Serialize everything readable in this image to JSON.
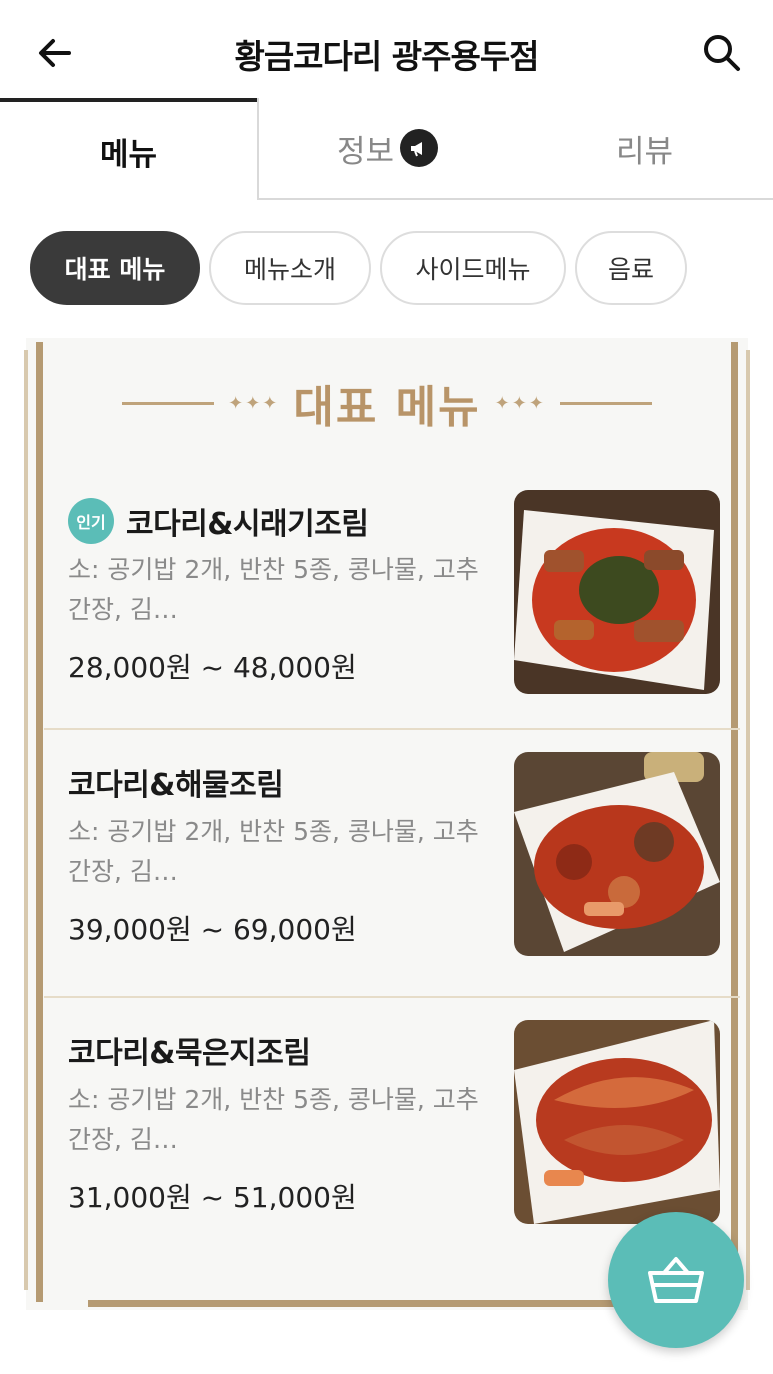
{
  "header": {
    "title": "황금코다리 광주용두점",
    "back_icon": "arrow-left-icon",
    "search_icon": "search-icon"
  },
  "tabs": [
    {
      "label": "메뉴",
      "active": true
    },
    {
      "label": "정보",
      "active": false,
      "icon": "megaphone-icon"
    },
    {
      "label": "리뷰",
      "active": false
    }
  ],
  "chips": [
    {
      "label": "대표 메뉴",
      "active": true
    },
    {
      "label": "메뉴소개",
      "active": false
    },
    {
      "label": "사이드메뉴",
      "active": false
    },
    {
      "label": "음료",
      "active": false
    }
  ],
  "section": {
    "title": "대표 메뉴"
  },
  "menu_items": [
    {
      "badge": "인기",
      "name": "코다리&시래기조림",
      "desc": "소: 공기밥 2개, 반찬 5종, 콩나물, 고추간장, 김…",
      "price": "28,000원 ~ 48,000원"
    },
    {
      "name": "코다리&해물조림",
      "desc": "소: 공기밥 2개, 반찬 5종, 콩나물, 고추간장, 김…",
      "price": "39,000원 ~ 69,000원"
    },
    {
      "name": "코다리&묵은지조림",
      "desc": "소: 공기밥 2개, 반찬 5종, 콩나물, 고추간장, 김…",
      "price": "31,000원 ~ 51,000원"
    }
  ],
  "colors": {
    "accent": "#5bbdb7",
    "gold": "#b89468",
    "frame": "#b59a72",
    "dark_chip": "#3a3a3a"
  },
  "cart_icon": "basket-icon"
}
